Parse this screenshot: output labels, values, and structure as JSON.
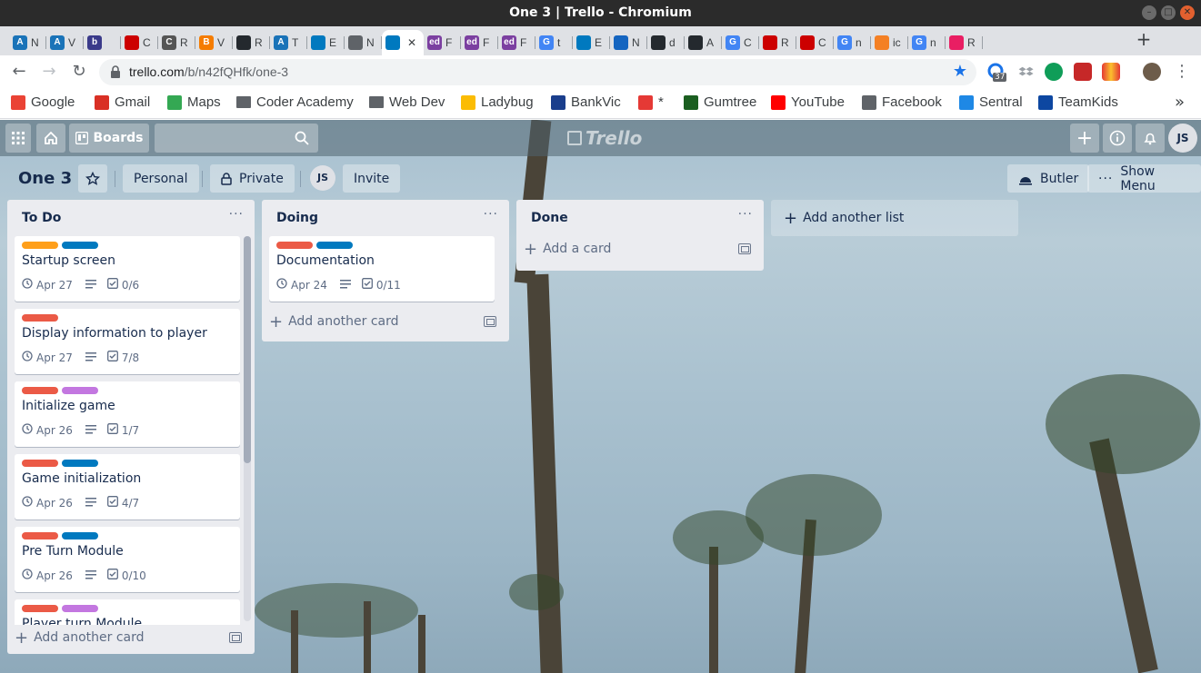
{
  "window": {
    "title": "One 3 | Trello - Chromium"
  },
  "tabs": [
    {
      "fav": "A",
      "color": "#1a73b8",
      "text": "N"
    },
    {
      "fav": "A",
      "color": "#1a73b8",
      "text": "V"
    },
    {
      "fav": "b",
      "color": "#3a3a8a",
      "text": ""
    },
    {
      "fav": "",
      "color": "#cc0000",
      "text": "C"
    },
    {
      "fav": "C",
      "color": "#555",
      "text": "R"
    },
    {
      "fav": "B",
      "color": "#f57c00",
      "text": "V"
    },
    {
      "fav": "",
      "color": "#24292e",
      "text": "R"
    },
    {
      "fav": "A",
      "color": "#1a73b8",
      "text": "T"
    },
    {
      "fav": "",
      "color": "#0079bf",
      "text": "E"
    },
    {
      "fav": "",
      "color": "#5f6368",
      "text": "N"
    },
    {
      "fav": "",
      "color": "#0079bf",
      "text": "",
      "active": true
    },
    {
      "fav": "ed",
      "color": "#7b3fa0",
      "text": "F"
    },
    {
      "fav": "ed",
      "color": "#7b3fa0",
      "text": "F"
    },
    {
      "fav": "ed",
      "color": "#7b3fa0",
      "text": "F"
    },
    {
      "fav": "G",
      "color": "#4285f4",
      "text": "t"
    },
    {
      "fav": "",
      "color": "#0079bf",
      "text": "E"
    },
    {
      "fav": "",
      "color": "#1565c0",
      "text": "N"
    },
    {
      "fav": "",
      "color": "#24292e",
      "text": "d"
    },
    {
      "fav": "",
      "color": "#24292e",
      "text": "A"
    },
    {
      "fav": "G",
      "color": "#4285f4",
      "text": "C"
    },
    {
      "fav": "",
      "color": "#cc0000",
      "text": "R"
    },
    {
      "fav": "",
      "color": "#cc0000",
      "text": "C"
    },
    {
      "fav": "G",
      "color": "#4285f4",
      "text": "n"
    },
    {
      "fav": "",
      "color": "#f48024",
      "text": "ic"
    },
    {
      "fav": "G",
      "color": "#4285f4",
      "text": "n"
    },
    {
      "fav": "",
      "color": "#e91e63",
      "text": "R"
    }
  ],
  "address": {
    "host": "trello.com",
    "path": "/b/n42fQHfk/one-3",
    "badge": "37"
  },
  "bookmarks": [
    {
      "label": "Google",
      "icon": "google-icon",
      "color": "#ea4335"
    },
    {
      "label": "Gmail",
      "icon": "gmail-icon",
      "color": "#d93025"
    },
    {
      "label": "Maps",
      "icon": "maps-icon",
      "color": "#34a853"
    },
    {
      "label": "Coder Academy",
      "icon": "folder-icon",
      "color": "#5f6368"
    },
    {
      "label": "Web Dev",
      "icon": "folder-icon",
      "color": "#5f6368"
    },
    {
      "label": "Ladybug",
      "icon": "drive-icon",
      "color": "#fbbc04"
    },
    {
      "label": "BankVic",
      "icon": "bankvic-icon",
      "color": "#1a3e8c"
    },
    {
      "label": "*",
      "icon": "gift-icon",
      "color": "#e53935"
    },
    {
      "label": "Gumtree",
      "icon": "gumtree-icon",
      "color": "#1b5e20"
    },
    {
      "label": "YouTube",
      "icon": "youtube-icon",
      "color": "#ff0000"
    },
    {
      "label": "Facebook",
      "icon": "globe-icon",
      "color": "#5f6368"
    },
    {
      "label": "Sentral",
      "icon": "sentral-icon",
      "color": "#1e88e5"
    },
    {
      "label": "TeamKids",
      "icon": "teamkids-icon",
      "color": "#0d47a1"
    }
  ],
  "header": {
    "boards_label": "Boards",
    "logo_text": "Trello",
    "avatar_initials": "JS"
  },
  "board": {
    "title": "One 3",
    "team_label": "Personal",
    "visibility_label": "Private",
    "member_initials": "JS",
    "invite_label": "Invite",
    "butler_label": "Butler",
    "menu_label": "Show Menu",
    "add_list_label": "Add another list"
  },
  "lists": [
    {
      "title": "To Do",
      "add_label": "Add another card",
      "cards": [
        {
          "labels": [
            "#ff9f1a",
            "#0079bf"
          ],
          "title": "Startup screen",
          "due": "Apr 27",
          "checklist": "0/6"
        },
        {
          "labels": [
            "#eb5a46"
          ],
          "title": "Display information to player",
          "due": "Apr 27",
          "checklist": "7/8"
        },
        {
          "labels": [
            "#eb5a46",
            "#c377e0"
          ],
          "title": "Initialize game",
          "due": "Apr 26",
          "checklist": "1/7"
        },
        {
          "labels": [
            "#eb5a46",
            "#0079bf"
          ],
          "title": "Game initialization",
          "due": "Apr 26",
          "checklist": "4/7"
        },
        {
          "labels": [
            "#eb5a46",
            "#0079bf"
          ],
          "title": "Pre Turn Module",
          "due": "Apr 26",
          "checklist": "0/10"
        },
        {
          "labels": [
            "#eb5a46",
            "#c377e0"
          ],
          "title": "Player turn Module",
          "due": "",
          "checklist": ""
        }
      ]
    },
    {
      "title": "Doing",
      "add_label": "Add another card",
      "cards": [
        {
          "labels": [
            "#eb5a46",
            "#0079bf"
          ],
          "title": "Documentation",
          "due": "Apr 24",
          "checklist": "0/11"
        }
      ]
    },
    {
      "title": "Done",
      "add_label": "Add a card",
      "cards": []
    }
  ]
}
